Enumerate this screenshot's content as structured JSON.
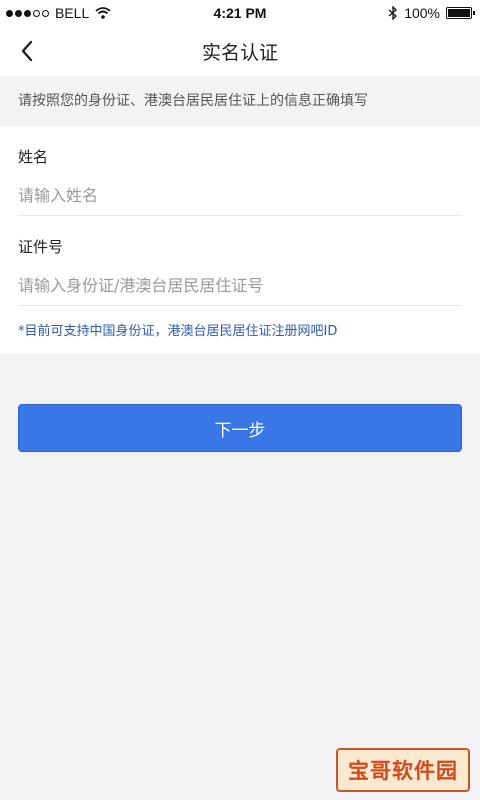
{
  "status_bar": {
    "carrier": "BELL",
    "time": "4:21 PM",
    "battery": "100%",
    "battery_level": 1.0,
    "signal_bars_filled": 3,
    "signal_bars_total": 5
  },
  "nav": {
    "title": "实名认证",
    "back_icon": "chevron-left-icon"
  },
  "notice": "请按照您的身份证、港澳台居民居住证上的信息正确填写",
  "form": {
    "name_label": "姓名",
    "name_placeholder": "请输入姓名",
    "name_value": "",
    "id_label": "证件号",
    "id_placeholder": "请输入身份证/港澳台居民居住证号",
    "id_value": "",
    "hint": "*目前可支持中国身份证，港澳台居民居住证注册网吧ID"
  },
  "next_button": "下一步",
  "watermark": "宝哥软件园",
  "colors": {
    "accent": "#3a77e6",
    "hint_text": "#2f5cae",
    "page_bg": "#f3f3f5"
  }
}
